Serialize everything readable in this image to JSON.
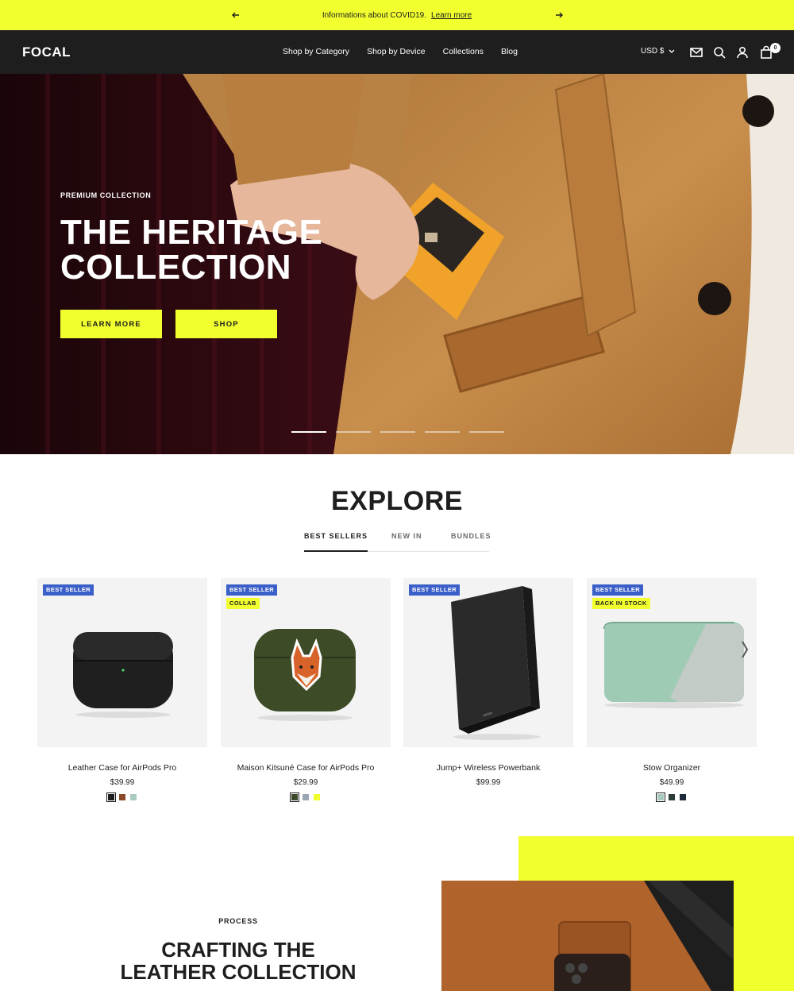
{
  "announcement": {
    "message": "Informations about COVID19.",
    "link": "Learn more"
  },
  "header": {
    "logo": "FOCAL",
    "nav": [
      "Shop by Category",
      "Shop by Device",
      "Collections",
      "Blog"
    ],
    "currency": "USD $",
    "cart_count": "0"
  },
  "hero": {
    "eyebrow": "PREMIUM COLLECTION",
    "title": "THE HERITAGE COLLECTION",
    "buttons": [
      "LEARN MORE",
      "SHOP"
    ],
    "slides": 5,
    "active_slide": 1
  },
  "explore": {
    "title": "EXPLORE",
    "tabs": [
      "BEST SELLERS",
      "NEW IN",
      "BUNDLES"
    ],
    "active_tab": "BEST SELLERS",
    "products": [
      {
        "name": "Leather Case for AirPods Pro",
        "price": "$39.99",
        "badges": [
          "BEST SELLER"
        ],
        "swatches": [
          "#1e1e1e",
          "#8a4a2a",
          "#a9cbbd"
        ]
      },
      {
        "name": "Maison Kitsuné Case for AirPods Pro",
        "price": "$29.99",
        "badges": [
          "BEST SELLER",
          "COLLAB"
        ],
        "swatches": [
          "#3d4a2a",
          "#9aa7b3",
          "#f1ff2e"
        ]
      },
      {
        "name": "Jump+ Wireless Powerbank",
        "price": "$99.99",
        "badges": [
          "BEST SELLER"
        ],
        "swatches": []
      },
      {
        "name": "Stow Organizer",
        "price": "$49.99",
        "badges": [
          "BEST SELLER",
          "BACK IN STOCK"
        ],
        "swatches": [
          "#a9cbbd",
          "#2d3a3a",
          "#1e2a3a"
        ]
      }
    ]
  },
  "process": {
    "eyebrow": "PROCESS",
    "title": "CRAFTING THE LEATHER COLLECTION"
  },
  "colors": {
    "accent": "#f1ff2e",
    "dark": "#1e1e1e",
    "badge_blue": "#3b5fc8"
  }
}
